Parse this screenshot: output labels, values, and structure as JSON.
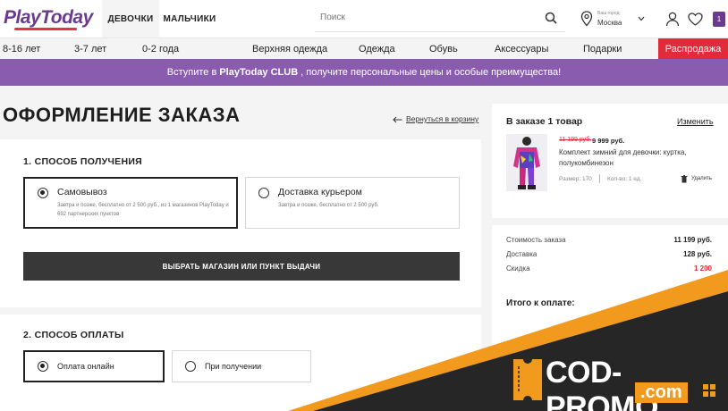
{
  "header": {
    "logo": "PlayToday",
    "gender_tabs": [
      {
        "label": "ДЕВОЧКИ",
        "active": true
      },
      {
        "label": "МАЛЬЧИКИ",
        "active": false
      }
    ],
    "search_placeholder": "Поиск",
    "city_label": "Ваш город:",
    "city_value": "Москва",
    "cart_count": "1"
  },
  "nav": {
    "items": [
      "8-16 лет",
      "3-7 лет",
      "0-2 года",
      "Верхняя одежда",
      "Одежда",
      "Обувь",
      "Аксессуары",
      "Подарки"
    ],
    "sale": "Распродажа"
  },
  "banner": {
    "prefix": "Вступите в",
    "brand": "PlayToday CLUB",
    "suffix": ", получите персональные цены и особые преимущества!"
  },
  "page_title": "ОФОРМЛЕНИЕ ЗАКАЗА",
  "back_link": "Вернуться в корзину",
  "delivery": {
    "heading": "1. СПОСОБ ПОЛУЧЕНИЯ",
    "options": [
      {
        "title": "Самовывоз",
        "desc": "Завтра и позже, бесплатно от 2 500 руб., из 1 магазинов PlayToday и 692 партнерских пунктов",
        "selected": true
      },
      {
        "title": "Доставка курьером",
        "desc": "Завтра и позже, бесплатно от 2 500 руб.",
        "selected": false
      }
    ],
    "button": "ВЫБРАТЬ МАГАЗИН ИЛИ ПУНКТ ВЫДАЧИ"
  },
  "payment": {
    "heading": "2. СПОСОБ ОПЛАТЫ",
    "options": [
      {
        "title": "Оплата онлайн",
        "selected": true
      },
      {
        "title": "При получении",
        "selected": false
      }
    ]
  },
  "order": {
    "heading": "В заказе 1 товар",
    "change": "Изменить",
    "item": {
      "old_price": "11 199 руб.",
      "price": "9 999 руб.",
      "name": "Комплект зимний для девочки: куртка, полукомбинезон",
      "size": "Размер: 170",
      "qty": "Кол-во: 1 ед.",
      "delete": "Удалить"
    },
    "summary": [
      {
        "label": "Стоимость заказа",
        "value": "11 199 руб.",
        "color": "#222222"
      },
      {
        "label": "Доставка",
        "value": "128 руб.",
        "color": "#222222"
      },
      {
        "label": "Скидка",
        "value": "1 200",
        "color": "#e22b3a"
      }
    ],
    "total_label": "Итого к оплате:"
  },
  "promo": {
    "line1": "COD-PROMO",
    "line2": ".com"
  },
  "colors": {
    "brand": "#6b3a8f",
    "sale": "#e22b3a",
    "banner": "#8a5cb0",
    "promo_orange": "#f29a1e"
  }
}
